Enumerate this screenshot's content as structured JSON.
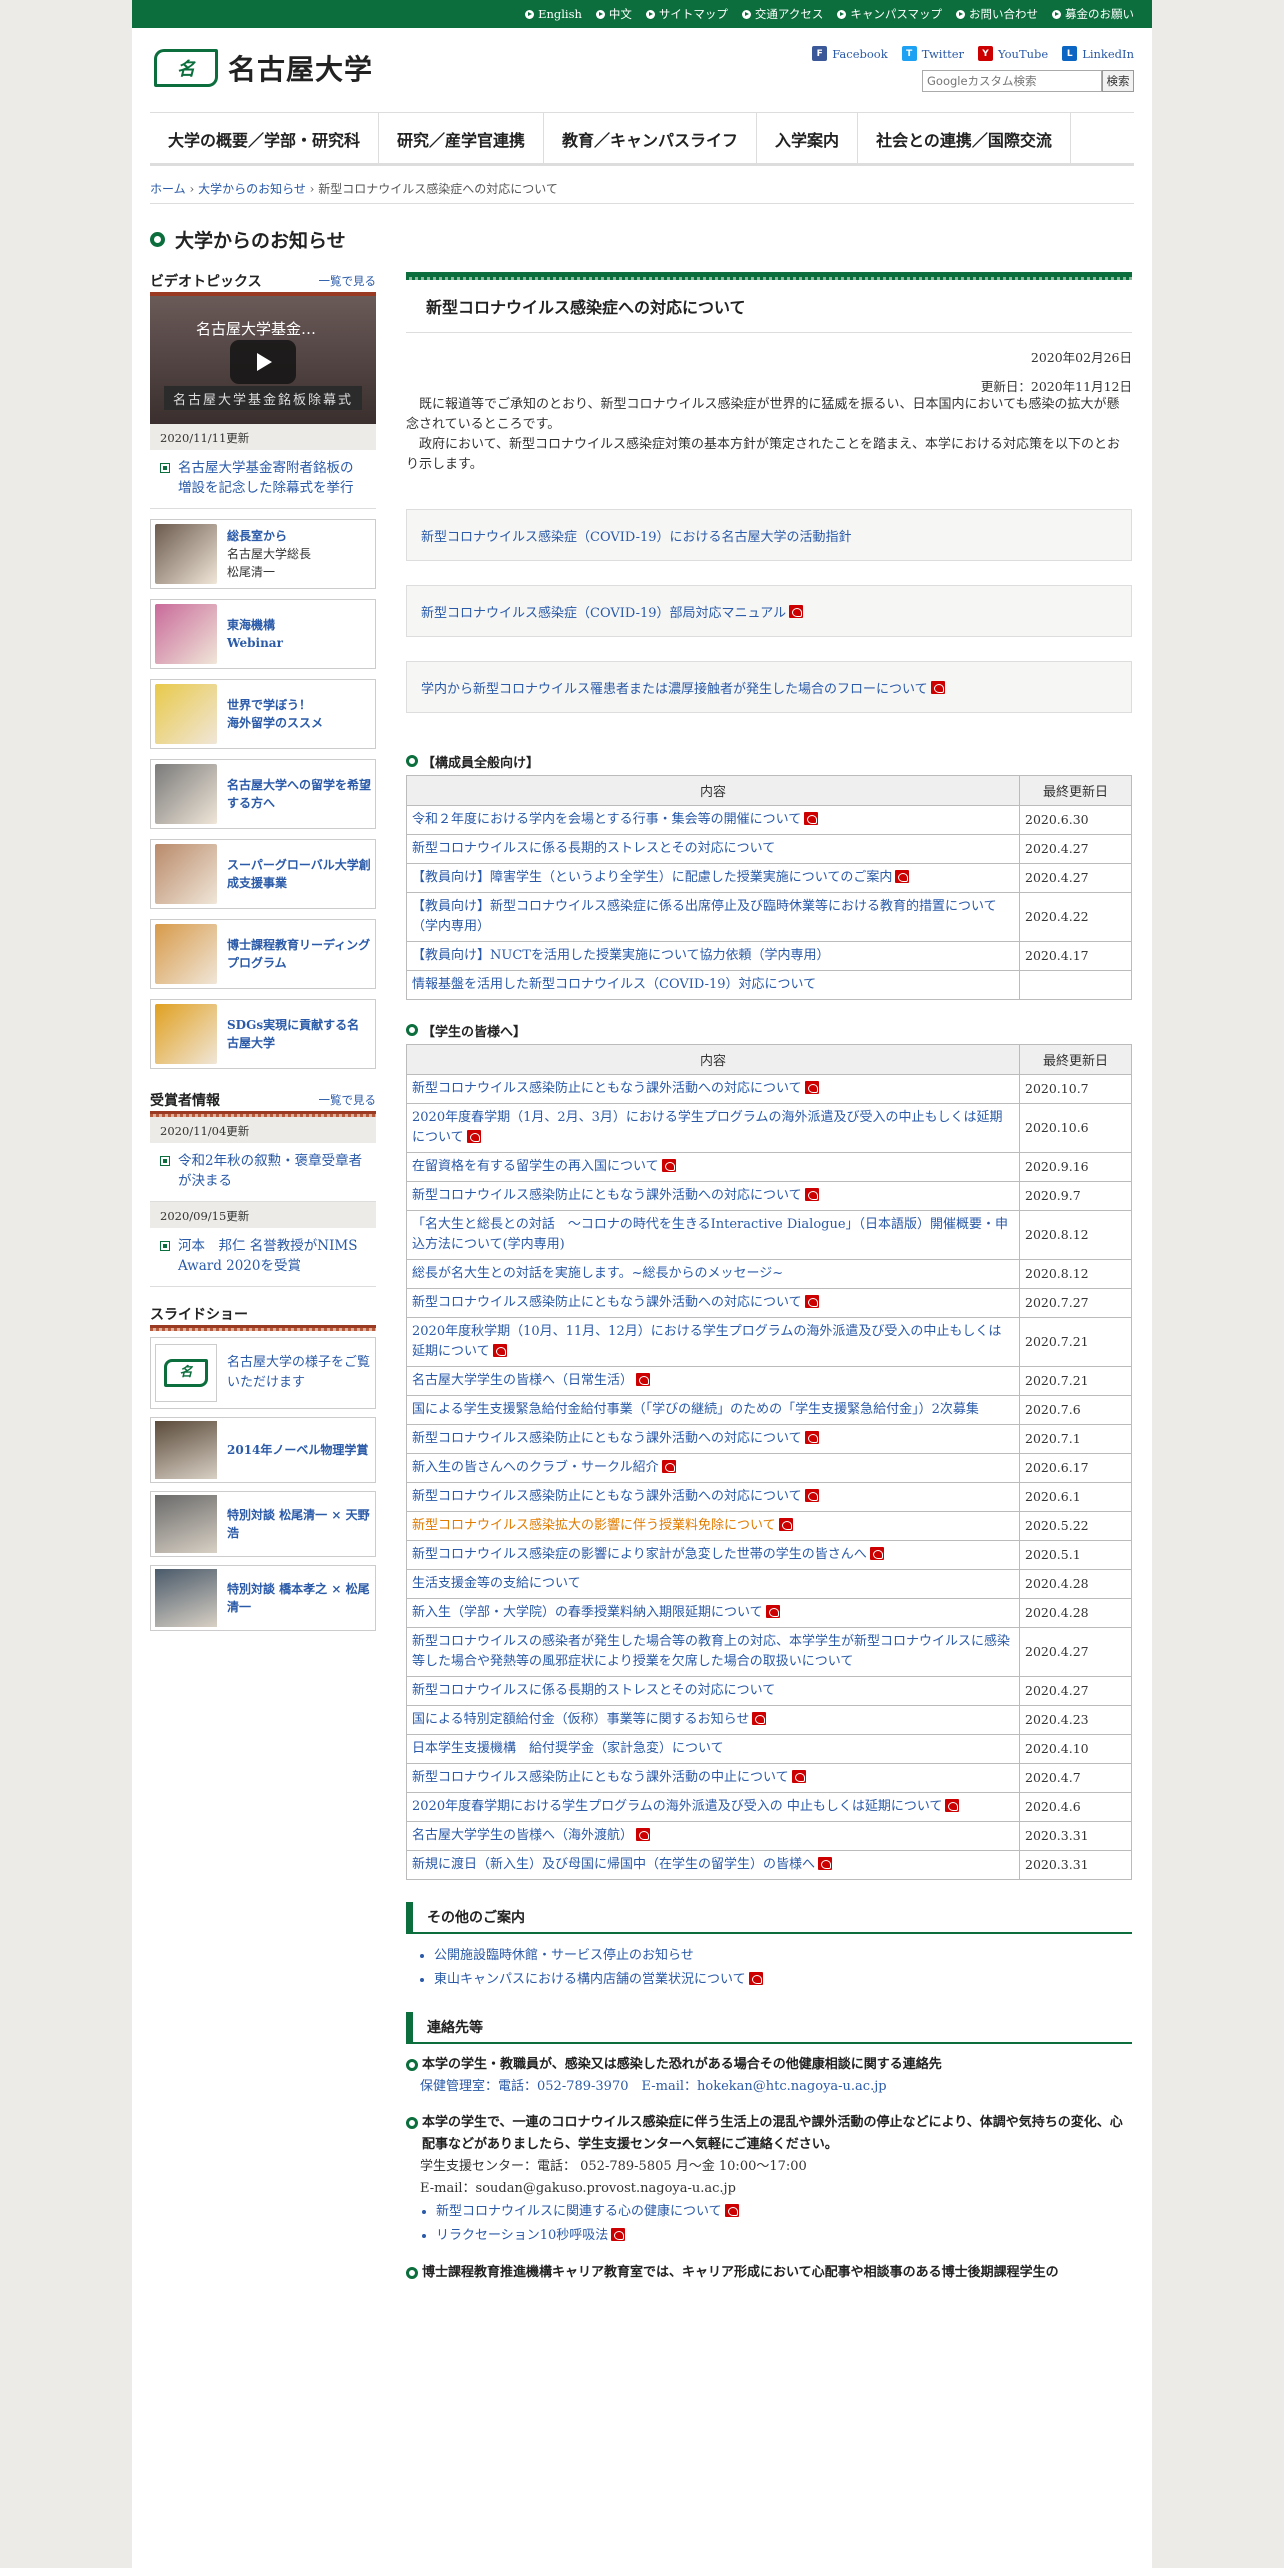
{
  "topbar": {
    "links": [
      "English",
      "中文",
      "サイトマップ",
      "交通アクセス",
      "キャンパスマップ",
      "お問い合わせ",
      "募金のお願い"
    ]
  },
  "header": {
    "logo_text": "名古屋大学",
    "social": [
      {
        "label": "Facebook",
        "icon": "facebook-icon",
        "color": "#3b5998"
      },
      {
        "label": "Twitter",
        "icon": "twitter-icon",
        "color": "#1da1f2"
      },
      {
        "label": "YouTube",
        "icon": "youtube-icon",
        "color": "#cc0000"
      },
      {
        "label": "LinkedIn",
        "icon": "linkedin-icon",
        "color": "#0a66c2"
      }
    ],
    "search_placeholder": "Googleカスタム検索",
    "search_button": "検索"
  },
  "nav": [
    "大学の概要／学部・研究科",
    "研究／産学官連携",
    "教育／キャンパスライフ",
    "入学案内",
    "社会との連携／国際交流"
  ],
  "breadcrumb": {
    "home": "ホーム",
    "sep": " › ",
    "parent": "大学からのお知らせ",
    "current": "新型コロナウイルス感染症への対応について"
  },
  "page_title": "大学からのお知らせ",
  "sidebar": {
    "video_head": "ビデオトピックス",
    "more": "一覧で見る",
    "video_title": "名古屋大学基金…",
    "video_banner": "名古屋大学基金銘板除幕式",
    "video_date": "2020/11/11更新",
    "video_item": "名古屋大学基金寄附者銘板の増設を記念した除幕式を挙行",
    "cards": [
      {
        "title": "総長室から",
        "sub1": "名古屋大学総長",
        "sub2": "松尾清一",
        "color": "#6b5a4e"
      },
      {
        "title": "東海機構",
        "sub1": "Webinar",
        "sub2": "",
        "color": "#c96a9a"
      },
      {
        "title": "世界で学ぼう！",
        "sub1": "海外留学のススメ",
        "sub2": "",
        "color": "#e8c94a"
      },
      {
        "title": "名古屋大学への留学を希望する方へ",
        "sub1": "",
        "sub2": "",
        "color": "#7a7a7a"
      },
      {
        "title": "スーパーグローバル大学創成支援事業",
        "sub1": "",
        "sub2": "",
        "color": "#b98a6a"
      },
      {
        "title": "博士課程教育リーディングプログラム",
        "sub1": "",
        "sub2": "",
        "color": "#d79a4a"
      },
      {
        "title": "SDGs実現に貢献する名古屋大学",
        "sub1": "",
        "sub2": "",
        "color": "#e0a020"
      }
    ],
    "award_head": "受賞者情報",
    "awards": [
      {
        "date": "2020/11/04更新",
        "text": "令和2年秋の叙勲・褒章受章者が決まる"
      },
      {
        "date": "2020/09/15更新",
        "text": "河本　邦仁 名誉教授がNIMS Award 2020を受賞"
      }
    ],
    "slide_head": "スライドショー",
    "slide_main": "名古屋大学の様子をご覧いただけます",
    "slides": [
      {
        "title": "2014年ノーベル物理学賞",
        "color": "#5a4a3a"
      },
      {
        "title": "特別対談 松尾清一 × 天野浩",
        "color": "#6a6a6a"
      },
      {
        "title": "特別対談 橋本孝之 × 松尾清一",
        "color": "#4a5a6a"
      }
    ]
  },
  "article": {
    "title": "新型コロナウイルス感染症への対応について",
    "date": "2020年02月26日",
    "updated": "更新日：2020年11月12日",
    "p1": "　既に報道等でご承知のとおり、新型コロナウイルス感染症が世界的に猛威を振るい、日本国内においても感染の拡大が懸念されているところです。",
    "p2": "　政府において、新型コロナウイルス感染症対策の基本方針が策定されたことを踏まえ、本学における対応策を以下のとおり示します。",
    "boxes": [
      {
        "text": "新型コロナウイルス感染症（COVID-19）における名古屋大学の活動指針",
        "pdf": false
      },
      {
        "text": "新型コロナウイルス感染症（COVID-19）部局対応マニュアル",
        "pdf": true
      },
      {
        "text": "学内から新型コロナウイルス罹患者または濃厚接触者が発生した場合のフローについて",
        "pdf": true
      }
    ],
    "col_content": "内容",
    "col_date": "最終更新日",
    "staff_head": "【構成員全般向け】",
    "staff_rows": [
      {
        "text": "令和２年度における学内を会場とする行事・集会等の開催について",
        "date": "2020.6.30",
        "pdf": true
      },
      {
        "text": "新型コロナウイルスに係る長期的ストレスとその対応について",
        "date": "2020.4.27",
        "pdf": false
      },
      {
        "text": "【教員向け】障害学生（というより全学生）に配慮した授業実施についてのご案内",
        "date": "2020.4.27",
        "pdf": true
      },
      {
        "text": "【教員向け】新型コロナウイルス感染症に係る出席停止及び臨時休業等における教育的措置について（学内専用）",
        "date": "2020.4.22",
        "pdf": false
      },
      {
        "text": "【教員向け】NUCTを活用した授業実施について協力依頼（学内専用）",
        "date": "2020.4.17",
        "pdf": false
      },
      {
        "text": "情報基盤を活用した新型コロナウイルス（COVID-19）対応について",
        "date": "",
        "pdf": false
      }
    ],
    "student_head": "【学生の皆様へ】",
    "student_rows": [
      {
        "text": "新型コロナウイルス感染防止にともなう課外活動への対応について",
        "date": "2020.10.7",
        "pdf": true
      },
      {
        "text": "2020年度春学期（1月、2月、3月）における学生プログラムの海外派遣及び受入の中止もしくは延期について",
        "date": "2020.10.6",
        "pdf": true
      },
      {
        "text": "在留資格を有する留学生の再入国について",
        "date": "2020.9.16",
        "pdf": true
      },
      {
        "text": "新型コロナウイルス感染防止にともなう課外活動への対応について",
        "date": "2020.9.7",
        "pdf": true
      },
      {
        "text": "「名大生と総長との対話　～コロナの時代を生きるInteractive Dialogue」（日本語版）開催概要・申込方法について(学内専用)",
        "date": "2020.8.12",
        "pdf": false
      },
      {
        "text": "総長が名大生との対話を実施します。~総長からのメッセージ~",
        "date": "2020.8.12",
        "pdf": false
      },
      {
        "text": "新型コロナウイルス感染防止にともなう課外活動への対応について",
        "date": "2020.7.27",
        "pdf": true
      },
      {
        "text": "2020年度秋学期（10月、11月、12月）における学生プログラムの海外派遣及び受入の中止もしくは延期について",
        "date": "2020.7.21",
        "pdf": true
      },
      {
        "text": "名古屋大学学生の皆様へ（日常生活）",
        "date": "2020.7.21",
        "pdf": true
      },
      {
        "text": "国による学生支援緊急給付金給付事業（「学びの継続」のための「学生支援緊急給付金」）2次募集",
        "date": "2020.7.6",
        "pdf": false
      },
      {
        "text": "新型コロナウイルス感染防止にともなう課外活動への対応について",
        "date": "2020.7.1",
        "pdf": true
      },
      {
        "text": "新入生の皆さんへのクラブ・サークル紹介",
        "date": "2020.6.17",
        "pdf": true
      },
      {
        "text": "新型コロナウイルス感染防止にともなう課外活動への対応について",
        "date": "2020.6.1",
        "pdf": true
      },
      {
        "text": "新型コロナウイルス感染拡大の影響に伴う授業料免除について",
        "date": "2020.5.22",
        "pdf": true,
        "orange": true
      },
      {
        "text": "新型コロナウイルス感染症の影響により家計が急変した世帯の学生の皆さんへ",
        "date": "2020.5.1",
        "pdf": true
      },
      {
        "text": "生活支援金等の支給について",
        "date": "2020.4.28",
        "pdf": false
      },
      {
        "text": "新入生（学部・大学院）の春季授業料納入期限延期について",
        "date": "2020.4.28",
        "pdf": true
      },
      {
        "text": "新型コロナウイルスの感染者が発生した場合等の教育上の対応、本学学生が新型コロナウイルスに感染等した場合や発熱等の風邪症状により授業を欠席した場合の取扱いについて",
        "date": "2020.4.27",
        "pdf": false
      },
      {
        "text": "新型コロナウイルスに係る長期的ストレスとその対応について",
        "date": "2020.4.27",
        "pdf": false
      },
      {
        "text": "国による特別定額給付金（仮称）事業等に関するお知らせ",
        "date": "2020.4.23",
        "pdf": true
      },
      {
        "text": "日本学生支援機構　給付奨学金（家計急変）について",
        "date": "2020.4.10",
        "pdf": false
      },
      {
        "text": "新型コロナウイルス感染防止にともなう課外活動の中止について",
        "date": "2020.4.7",
        "pdf": true
      },
      {
        "text": "2020年度春学期における学生プログラムの海外派遣及び受入の 中止もしくは延期について",
        "date": "2020.4.6",
        "pdf": true
      },
      {
        "text": "名古屋大学学生の皆様へ（海外渡航）",
        "date": "2020.3.31",
        "pdf": true
      },
      {
        "text": "新規に渡日（新入生）及び母国に帰国中（在学生の留学生）の皆様へ",
        "date": "2020.3.31",
        "pdf": true
      }
    ],
    "other_head": "その他のご案内",
    "other_items": [
      {
        "text": "公開施設臨時休館・サービス停止のお知らせ",
        "pdf": false
      },
      {
        "text": "東山キャンパスにおける構内店舗の営業状況について",
        "pdf": true
      }
    ],
    "contact_head": "連絡先等",
    "contact1_head": "本学の学生・教職員が、感染又は感染した恐れがある場合その他健康相談に関する連絡先",
    "contact1_body": "保健管理室：電話：052-789-3970　E-mail：hokekan@htc.nagoya-u.ac.jp",
    "contact2_head": "本学の学生で、一連のコロナウイルス感染症に伴う生活上の混乱や課外活動の停止などにより、体調や気持ちの変化、心配事などがありましたら、学生支援センターへ気軽にご連絡ください。",
    "contact2_line1": "学生支援センター：電話： 052-789-5805 月〜金 10:00〜17:00",
    "contact2_line2": "E-mail：soudan@gakuso.provost.nagoya-u.ac.jp",
    "contact2_links": [
      {
        "text": "新型コロナウイルスに関連する心の健康について",
        "pdf": true
      },
      {
        "text": "リラクセーション10秒呼吸法",
        "pdf": true
      }
    ],
    "contact3_head": "博士課程教育推進機構キャリア教育室では、キャリア形成において心配事や相談事のある博士後期課程学生の"
  },
  "colors": {
    "brand_green": "#0b6e3c",
    "link": "#2a5aa8",
    "accent_orange": "#e07b00"
  }
}
